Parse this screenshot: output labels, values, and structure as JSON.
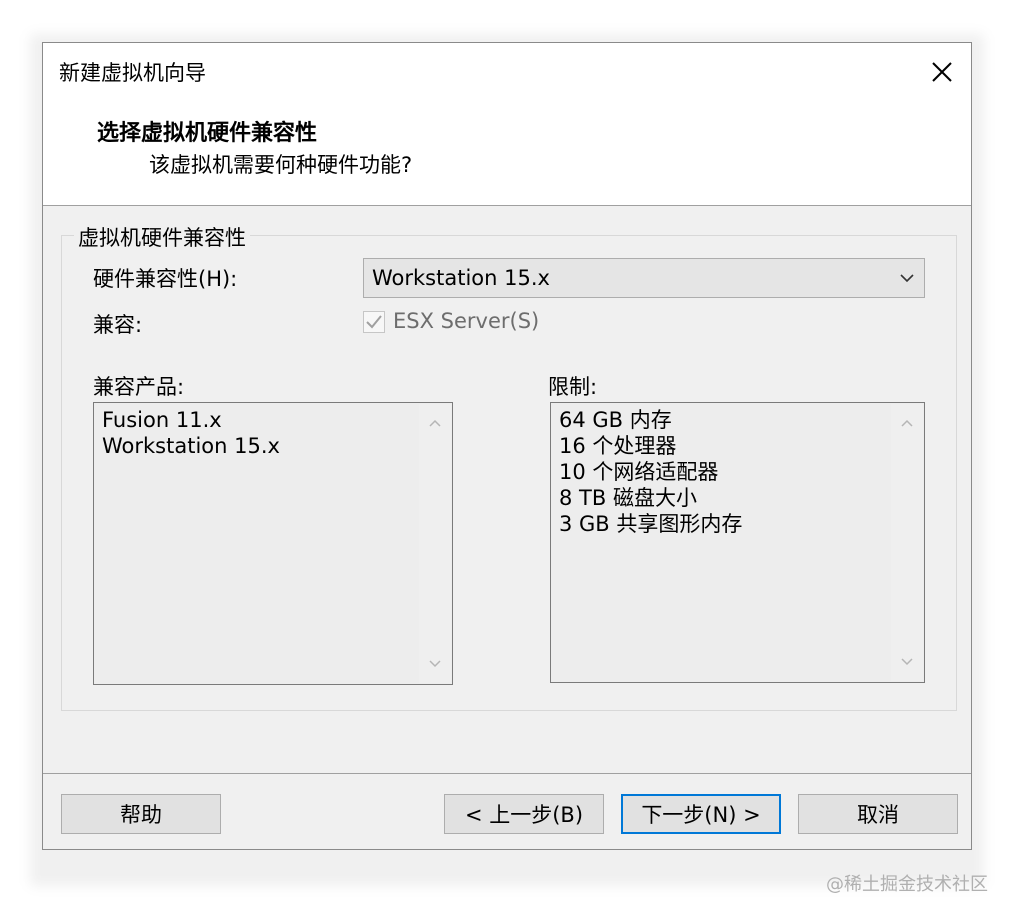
{
  "window": {
    "title": "新建虚拟机向导",
    "close_icon": "close-icon"
  },
  "header": {
    "title": "选择虚拟机硬件兼容性",
    "subtitle": "该虚拟机需要何种硬件功能?"
  },
  "group": {
    "legend": "虚拟机硬件兼容性",
    "hardware_compat_label": "硬件兼容性(H):",
    "hardware_compat_value": "Workstation 15.x",
    "compatible_label": "兼容:",
    "esx_checkbox_label": "ESX Server(S)",
    "esx_checked": true,
    "esx_enabled": false
  },
  "compatible_products": {
    "label": "兼容产品:",
    "items": [
      "Fusion 11.x",
      "Workstation 15.x"
    ]
  },
  "limits": {
    "label": "限制:",
    "items": [
      "64 GB 内存",
      "16 个处理器",
      "10 个网络适配器",
      "8 TB 磁盘大小",
      "3 GB 共享图形内存"
    ]
  },
  "buttons": {
    "help": "帮助",
    "back": "< 上一步(B)",
    "next": "下一步(N) >",
    "cancel": "取消"
  },
  "watermark": "@稀土掘金技术社区",
  "colors": {
    "default_button_border": "#0078d7",
    "dialog_background": "#f0f0f0",
    "disabled_text": "#6d6d6d"
  }
}
